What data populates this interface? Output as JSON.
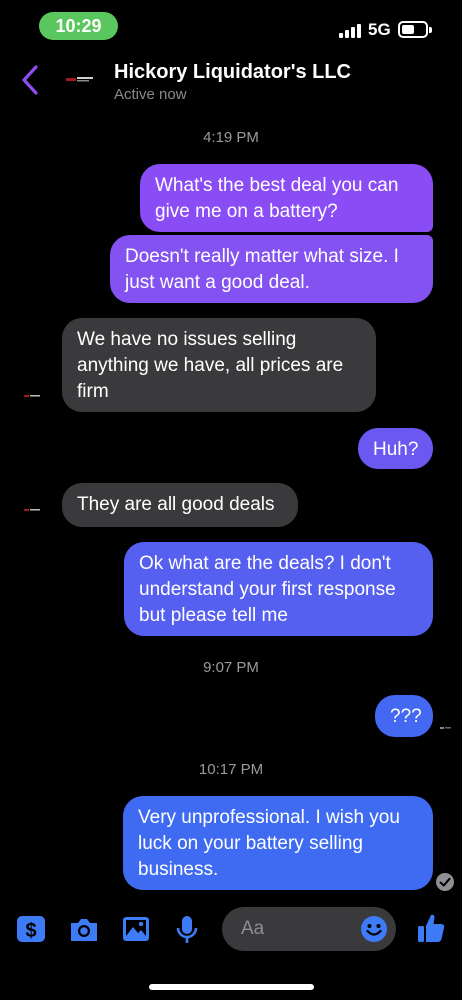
{
  "status_bar": {
    "time": "10:29",
    "network": "5G"
  },
  "header": {
    "contact_name": "Hickory Liquidator's LLC",
    "contact_status": "Active now"
  },
  "thread": {
    "timestamps": [
      "4:19 PM",
      "9:07 PM",
      "10:17 PM"
    ],
    "messages": [
      {
        "sender": "me",
        "text": "What's the best deal you can\ngive me on a battery?"
      },
      {
        "sender": "me",
        "text": "Doesn't really matter what size. I\njust want a good deal."
      },
      {
        "sender": "contact",
        "text": "We have no issues selling\nanything we have, all prices are\nfirm"
      },
      {
        "sender": "me",
        "text": "Huh?"
      },
      {
        "sender": "contact",
        "text": "They are all good deals"
      },
      {
        "sender": "me",
        "text": "Ok what are the deals? I don't\nunderstand your first response\nbut please tell me"
      },
      {
        "sender": "me",
        "text": "???"
      },
      {
        "sender": "me",
        "text": "Very unprofessional. I wish you\nluck on your battery selling\nbusiness."
      }
    ]
  },
  "composer": {
    "placeholder": "Aa",
    "icons": [
      "dollar-icon",
      "camera-icon",
      "image-icon",
      "mic-icon",
      "emoji-icon",
      "thumbs-up-icon"
    ]
  },
  "colors": {
    "accent": "#8f4bf5",
    "bubble_purple": "#8a4cf4",
    "bubble_blue": "#3f6bf2",
    "incoming_bubble": "#3a3a3c",
    "icon_blue": "#3e7bf7",
    "status_green": "#5ac65e"
  }
}
